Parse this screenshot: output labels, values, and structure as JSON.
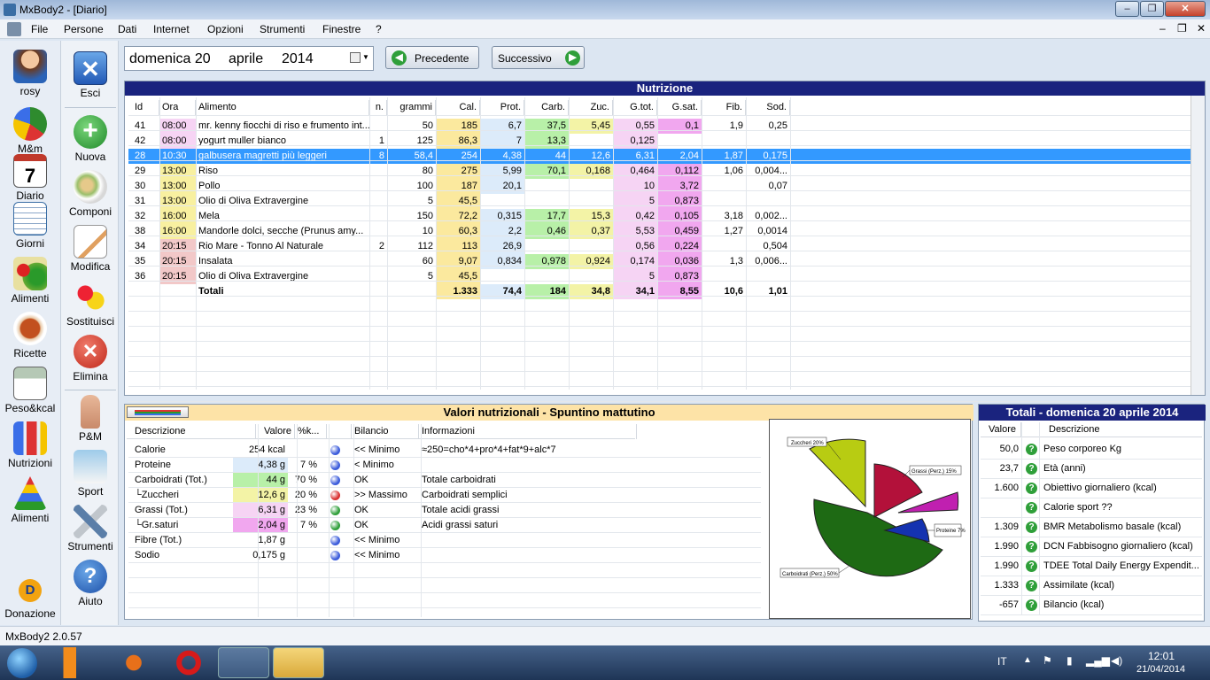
{
  "window": {
    "title": "MxBody2 - [Diario]"
  },
  "menu": [
    "File",
    "Persone",
    "Dati",
    "Internet",
    "Opzioni",
    "Strumenti",
    "Finestre",
    "?"
  ],
  "left_nav": [
    {
      "label": "rosy",
      "icon": "user-avatar-icon"
    },
    {
      "label": "M&m",
      "icon": "pie-chart-icon"
    },
    {
      "label": "Diario",
      "icon": "calendar-icon"
    },
    {
      "label": "Giorni",
      "icon": "days-grid-icon"
    },
    {
      "label": "Alimenti",
      "icon": "vegetables-icon"
    },
    {
      "label": "Ricette",
      "icon": "recipe-dish-icon"
    },
    {
      "label": "Peso&kcal",
      "icon": "scale-chart-icon"
    },
    {
      "label": "Nutrizioni",
      "icon": "nutrition-chart-icon"
    },
    {
      "label": "Alimenti",
      "icon": "food-pyramid-icon"
    },
    {
      "label": "Donazione",
      "icon": "donation-icon"
    }
  ],
  "actions": [
    {
      "label": "Esci",
      "icon": "exit-icon"
    },
    {
      "label": "Nuova",
      "icon": "add-icon"
    },
    {
      "label": "Componi",
      "icon": "compose-dish-icon"
    },
    {
      "label": "Modifica",
      "icon": "edit-pencil-icon"
    },
    {
      "label": "Sostituisci",
      "icon": "replace-fruit-icon"
    },
    {
      "label": "Elimina",
      "icon": "delete-icon"
    },
    {
      "label": "P&M",
      "icon": "body-figure-icon"
    },
    {
      "label": "Sport",
      "icon": "runner-icon"
    },
    {
      "label": "Strumenti",
      "icon": "tools-icon"
    },
    {
      "label": "Aiuto",
      "icon": "help-icon"
    }
  ],
  "date": {
    "day": "domenica 20",
    "month": "aprile",
    "year": "2014"
  },
  "nav_buttons": {
    "prev": "Precedente",
    "next": "Successivo"
  },
  "nutrizione": {
    "title": "Nutrizione",
    "columns": [
      "Id",
      "Ora",
      "Alimento",
      "n.",
      "grammi",
      "Cal.",
      "Prot.",
      "Carb.",
      "Zuc.",
      "G.tot.",
      "G.sat.",
      "Fib.",
      "Sod."
    ],
    "rows": [
      [
        "41",
        "08:00",
        "mr. kenny fiocchi di riso e frumento int...",
        "",
        "50",
        "185",
        "6,7",
        "37,5",
        "5,45",
        "0,55",
        "0,1",
        "1,9",
        "0,25"
      ],
      [
        "42",
        "08:00",
        "yogurt muller bianco",
        "1",
        "125",
        "86,3",
        "7",
        "13,3",
        "",
        "0,125",
        "",
        "",
        ""
      ],
      [
        "28",
        "10:30",
        "galbusera magretti più leggeri",
        "8",
        "58,4",
        "254",
        "4,38",
        "44",
        "12,6",
        "6,31",
        "2,04",
        "1,87",
        "0,175"
      ],
      [
        "29",
        "13:00",
        "Riso",
        "",
        "80",
        "275",
        "5,99",
        "70,1",
        "0,168",
        "0,464",
        "0,112",
        "1,06",
        "0,004..."
      ],
      [
        "30",
        "13:00",
        "Pollo",
        "",
        "100",
        "187",
        "20,1",
        "",
        "",
        "10",
        "3,72",
        "",
        "0,07"
      ],
      [
        "31",
        "13:00",
        "Olio di Oliva Extravergine",
        "",
        "5",
        "45,5",
        "",
        "",
        "",
        "5",
        "0,873",
        "",
        ""
      ],
      [
        "32",
        "16:00",
        "Mela",
        "",
        "150",
        "72,2",
        "0,315",
        "17,7",
        "15,3",
        "0,42",
        "0,105",
        "3,18",
        "0,002..."
      ],
      [
        "38",
        "16:00",
        "Mandorle dolci, secche  (Prunus amy...",
        "",
        "10",
        "60,3",
        "2,2",
        "0,46",
        "0,37",
        "5,53",
        "0,459",
        "1,27",
        "0,0014"
      ],
      [
        "34",
        "20:15",
        "Rio Mare - Tonno Al Naturale",
        "2",
        "112",
        "113",
        "26,9",
        "",
        "",
        "0,56",
        "0,224",
        "",
        "0,504"
      ],
      [
        "35",
        "20:15",
        "Insalata",
        "",
        "60",
        "9,07",
        "0,834",
        "0,978",
        "0,924",
        "0,174",
        "0,036",
        "1,3",
        "0,006..."
      ],
      [
        "36",
        "20:15",
        "Olio di Oliva Extravergine",
        "",
        "5",
        "45,5",
        "",
        "",
        "",
        "5",
        "0,873",
        "",
        ""
      ]
    ],
    "selected_row": 2,
    "totals": [
      "",
      "",
      "Totali",
      "",
      "",
      "1.333",
      "74,4",
      "184",
      "34,8",
      "34,1",
      "8,55",
      "10,6",
      "1,01"
    ]
  },
  "valori": {
    "title": "Valori nutrizionali - Spuntino mattutino",
    "columns": [
      "Descrizione",
      "Valore",
      "%k...",
      "",
      "Bilancio",
      "Informazioni"
    ],
    "rows": [
      {
        "desc": "Calorie",
        "val": "254 kcal",
        "pct": "",
        "dot": "#3b5bdb",
        "bil": "<< Minimo",
        "info": "≈250=cho*4+pro*4+fat*9+alc*7",
        "bg": ""
      },
      {
        "desc": "Proteine",
        "val": "4,38 g",
        "pct": "7 %",
        "dot": "#3b5bdb",
        "bil": "< Minimo",
        "info": "",
        "bg": "#dcebfa"
      },
      {
        "desc": "Carboidrati (Tot.)",
        "val": "44 g",
        "pct": "70 %",
        "dot": "#3b5bdb",
        "bil": "OK",
        "info": "Totale carboidrati",
        "bg": "#b8f0a8"
      },
      {
        "desc": "└Zuccheri",
        "val": "12,6 g",
        "pct": "20 %",
        "dot": "#d93030",
        "bil": ">> Massimo",
        "info": "Carboidrati semplici",
        "bg": "#f3f3a6"
      },
      {
        "desc": "Grassi (Tot.)",
        "val": "6,31 g",
        "pct": "23 %",
        "dot": "#2f9f3a",
        "bil": "OK",
        "info": "Totale acidi grassi",
        "bg": "#f6d4f4"
      },
      {
        "desc": "└Gr.saturi",
        "val": "2,04 g",
        "pct": "7 %",
        "dot": "#2f9f3a",
        "bil": "OK",
        "info": "Acidi grassi saturi",
        "bg": "#f1a7ef"
      },
      {
        "desc": "Fibre (Tot.)",
        "val": "1,87 g",
        "pct": "",
        "dot": "#3b5bdb",
        "bil": "<< Minimo",
        "info": "",
        "bg": ""
      },
      {
        "desc": "Sodio",
        "val": "0,175 g",
        "pct": "",
        "dot": "#3b5bdb",
        "bil": "<< Minimo",
        "info": "",
        "bg": ""
      }
    ]
  },
  "pie": {
    "labels": [
      "Zuccheri 20%",
      "Grassi (Perz.) 15%",
      "Proteine 7%",
      "Carboidrati (Perz.) 50%"
    ],
    "colors": {
      "zuccheri": "#b8cc12",
      "grassi": "#b3113a",
      "saturi": "#c020b0",
      "proteine": "#1432b0",
      "carboidrati": "#1e6a14"
    }
  },
  "totali": {
    "title": "Totali - domenica 20 aprile 2014",
    "columns": [
      "Valore",
      "Descrizione"
    ],
    "rows": [
      [
        "50,0",
        "Peso corporeo Kg"
      ],
      [
        "23,7",
        "Età (anni)"
      ],
      [
        "1.600",
        "Obiettivo giornaliero (kcal)"
      ],
      [
        "",
        "Calorie sport ??"
      ],
      [
        "1.309",
        "BMR Metabolismo basale (kcal)"
      ],
      [
        "1.990",
        "DCN Fabbisogno giornaliero (kcal)"
      ],
      [
        "1.990",
        "TDEE Total Daily Energy Expendit..."
      ],
      [
        "1.333",
        "Assimilate (kcal)"
      ],
      [
        "-657",
        "Bilancio (kcal)"
      ]
    ]
  },
  "status": "MxBody2 2.0.57",
  "taskbar": {
    "lang": "IT",
    "time": "12:01",
    "date": "21/04/2014"
  }
}
